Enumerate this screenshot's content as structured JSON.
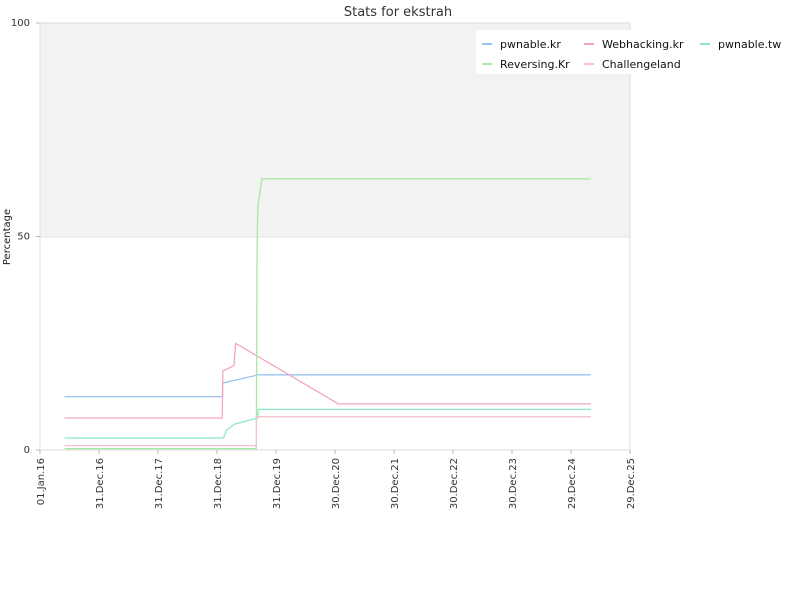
{
  "chart_data": {
    "type": "line",
    "title": "Stats for ekstrah",
    "xlabel": "",
    "ylabel": "Percentage",
    "ylim": [
      0,
      100
    ],
    "yticks": [
      0,
      50,
      100
    ],
    "xlim": [
      "2016-01-01",
      "2025-12-29"
    ],
    "xticks": [
      {
        "date": "2016-01-01",
        "label": "01.Jan.16"
      },
      {
        "date": "2016-12-31",
        "label": "31.Dec.16"
      },
      {
        "date": "2017-12-31",
        "label": "31.Dec.17"
      },
      {
        "date": "2018-12-31",
        "label": "31.Dec.18"
      },
      {
        "date": "2019-12-31",
        "label": "31.Dec.19"
      },
      {
        "date": "2020-12-30",
        "label": "30.Dec.20"
      },
      {
        "date": "2021-12-30",
        "label": "30.Dec.21"
      },
      {
        "date": "2022-12-30",
        "label": "30.Dec.22"
      },
      {
        "date": "2023-12-30",
        "label": "30.Dec.23"
      },
      {
        "date": "2024-12-29",
        "label": "29.Dec.24"
      },
      {
        "date": "2025-12-29",
        "label": "29.Dec.25"
      }
    ],
    "grid": true,
    "legend_position": "top-right",
    "series": [
      {
        "name": "pwnable.kr",
        "color": "#99c2f0",
        "points": [
          [
            "2016-06-01",
            12.5
          ],
          [
            "2019-02-03",
            12.5
          ],
          [
            "2019-02-04",
            15.7
          ],
          [
            "2019-09-15",
            17.6
          ],
          [
            "2025-05-01",
            17.6
          ]
        ]
      },
      {
        "name": "Webhacking.kr",
        "color": "#f4a7bd",
        "points": [
          [
            "2016-06-01",
            7.5
          ],
          [
            "2019-02-02",
            7.5
          ],
          [
            "2019-02-05",
            18.5
          ],
          [
            "2019-04-15",
            19.8
          ],
          [
            "2019-04-25",
            25.0
          ],
          [
            "2021-01-20",
            10.8
          ],
          [
            "2025-05-01",
            10.8
          ]
        ]
      },
      {
        "name": "pwnable.tw",
        "color": "#8ee6c8",
        "points": [
          [
            "2016-06-01",
            2.8
          ],
          [
            "2019-02-10",
            2.8
          ],
          [
            "2019-02-25",
            4.5
          ],
          [
            "2019-04-15",
            6.0
          ],
          [
            "2019-07-20",
            7.0
          ],
          [
            "2019-09-10",
            7.5
          ],
          [
            "2019-09-11",
            9.5
          ],
          [
            "2025-05-01",
            9.5
          ]
        ]
      },
      {
        "name": "Reversing.Kr",
        "color": "#a8e8a4",
        "points": [
          [
            "2016-06-01",
            0.3
          ],
          [
            "2019-08-31",
            0.3
          ],
          [
            "2019-09-05",
            48.0
          ],
          [
            "2019-09-10",
            57.0
          ],
          [
            "2019-10-05",
            63.5
          ],
          [
            "2025-05-01",
            63.5
          ]
        ]
      },
      {
        "name": "Challengeland",
        "color": "#f4c5cb",
        "points": [
          [
            "2016-06-01",
            1.0
          ],
          [
            "2019-08-31",
            1.0
          ],
          [
            "2019-09-01",
            7.8
          ],
          [
            "2025-05-01",
            7.8
          ]
        ]
      }
    ]
  }
}
